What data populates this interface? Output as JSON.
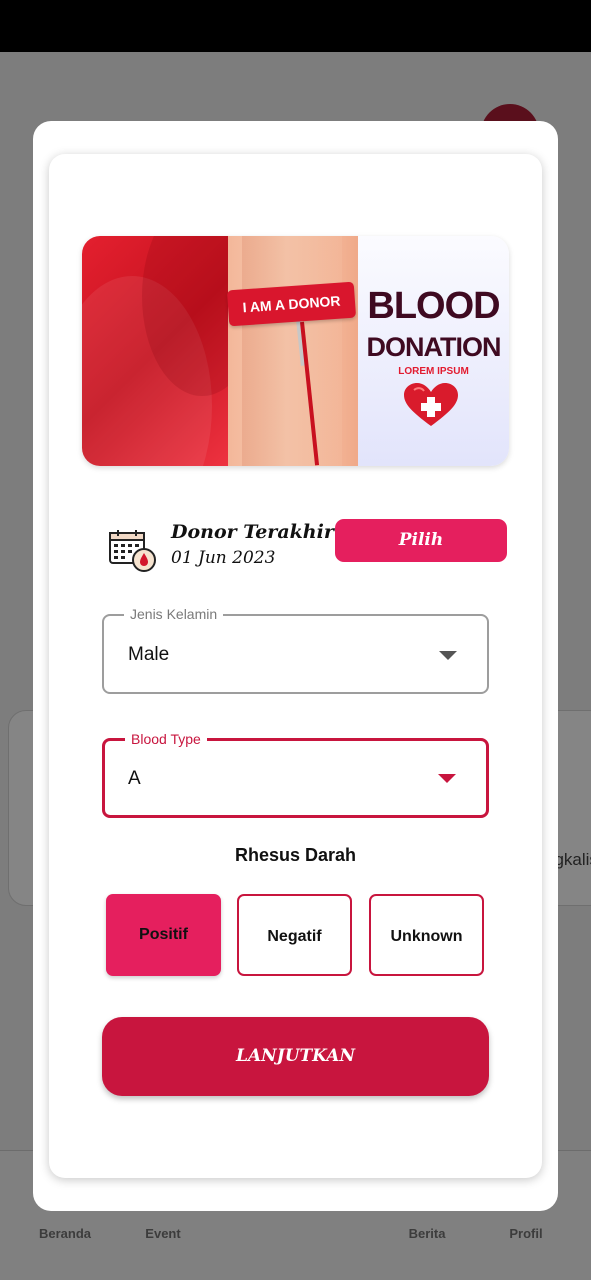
{
  "background": {
    "card_text": "ngkalis",
    "nav": [
      "Beranda",
      "Event",
      "Berita",
      "Profil"
    ]
  },
  "banner": {
    "bandage_text": "I AM A DONOR",
    "title_line1": "BLOOD",
    "title_line2": "DONATION",
    "subtitle": "LOREM IPSUM"
  },
  "donor": {
    "title": "Donor Terakhir",
    "date": "01 Jun 2023",
    "pick_label": "Pilih"
  },
  "gender_field": {
    "label": "Jenis Kelamin",
    "value": "Male"
  },
  "blood_field": {
    "label": "Blood Type",
    "value": "A"
  },
  "rhesus": {
    "title": "Rhesus Darah",
    "options": [
      "Positif",
      "Negatif",
      "Unknown"
    ],
    "selected": "Positif"
  },
  "submit_label": "LANJUTKAN",
  "colors": {
    "primary": "#c8153e",
    "accent": "#e51f5e"
  }
}
